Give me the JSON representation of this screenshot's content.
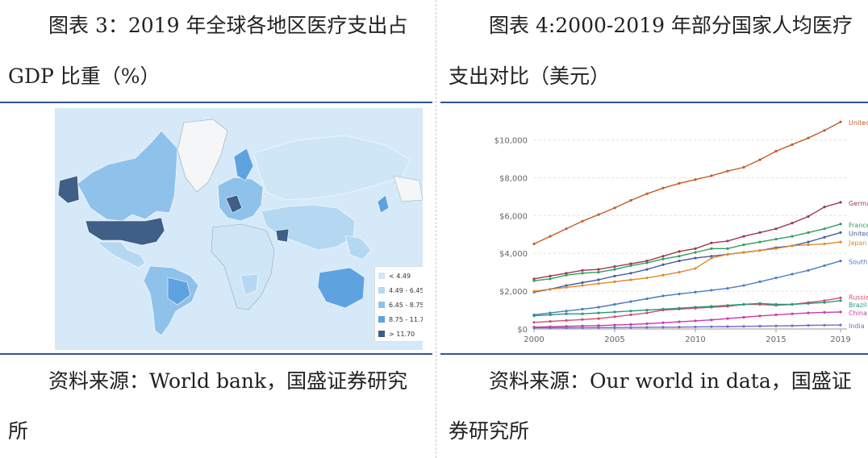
{
  "left": {
    "caption": "图表 3：2019 年全球各地区医疗支出占 GDP 比重（%）",
    "legend": [
      {
        "label": "< 4.49",
        "color": "#cfe6f7"
      },
      {
        "label": "4.49 - 6.45",
        "color": "#b4d8f2"
      },
      {
        "label": "6.45 - 8.75",
        "color": "#8fc2ea"
      },
      {
        "label": "8.75 - 11.70",
        "color": "#5ea3e0"
      },
      {
        "label": "> 11.70",
        "color": "#3f5f86"
      }
    ],
    "source": "资料来源：World bank，国盛证券研究所"
  },
  "right": {
    "caption": "图表 4:2000-2019 年部分国家人均医疗支出对比（美元）",
    "source": "资料来源：Our world in data，国盛证券研究所"
  },
  "chart_data": {
    "type": "line",
    "x": [
      2000,
      2001,
      2002,
      2003,
      2004,
      2005,
      2006,
      2007,
      2008,
      2009,
      2010,
      2011,
      2012,
      2013,
      2014,
      2015,
      2016,
      2017,
      2018,
      2019
    ],
    "xticks": [
      "2000",
      "2005",
      "2010",
      "2015",
      "2019"
    ],
    "yticks": [
      "$0",
      "$2,000",
      "$4,000",
      "$6,000",
      "$8,000",
      "$10,000"
    ],
    "ylim": [
      0,
      11000
    ],
    "xlim": [
      2000,
      2019
    ],
    "series": [
      {
        "name": "United",
        "color": "#c65a28",
        "values": [
          4500,
          4900,
          5300,
          5700,
          6050,
          6400,
          6800,
          7150,
          7450,
          7700,
          7900,
          8100,
          8350,
          8550,
          8950,
          9400,
          9750,
          10100,
          10500,
          10950
        ]
      },
      {
        "name": "Germa",
        "color": "#9b3a4f",
        "values": [
          2650,
          2800,
          2950,
          3100,
          3150,
          3300,
          3450,
          3600,
          3850,
          4100,
          4250,
          4550,
          4650,
          4900,
          5100,
          5300,
          5600,
          5950,
          6450,
          6700
        ]
      },
      {
        "name": "France",
        "color": "#2e9e5c",
        "values": [
          2550,
          2650,
          2850,
          2950,
          3000,
          3150,
          3350,
          3500,
          3700,
          3850,
          4050,
          4250,
          4250,
          4450,
          4600,
          4750,
          4900,
          5100,
          5300,
          5550
        ]
      },
      {
        "name": "United",
        "color": "#4a5aa8",
        "values": [
          1950,
          2100,
          2300,
          2450,
          2600,
          2800,
          2950,
          3150,
          3400,
          3600,
          3750,
          3850,
          3950,
          4050,
          4150,
          4300,
          4400,
          4600,
          4850,
          5100
        ]
      },
      {
        "name": "Japan",
        "color": "#e08a2a",
        "values": [
          2000,
          2100,
          2200,
          2300,
          2400,
          2500,
          2600,
          2700,
          2850,
          3000,
          3200,
          3750,
          3950,
          4050,
          4150,
          4250,
          4400,
          4450,
          4500,
          4600
        ]
      },
      {
        "name": "South",
        "color": "#4a7cc2",
        "values": [
          750,
          850,
          950,
          1050,
          1150,
          1300,
          1450,
          1600,
          1750,
          1850,
          1950,
          2050,
          2150,
          2300,
          2500,
          2700,
          2900,
          3100,
          3350,
          3600
        ]
      },
      {
        "name": "Russia",
        "color": "#d94a6a",
        "values": [
          350,
          400,
          450,
          500,
          550,
          650,
          750,
          850,
          1000,
          1050,
          1100,
          1150,
          1200,
          1300,
          1300,
          1250,
          1300,
          1400,
          1500,
          1650
        ]
      },
      {
        "name": "Brazil",
        "color": "#259a7a",
        "values": [
          700,
          750,
          800,
          800,
          850,
          900,
          950,
          1000,
          1050,
          1100,
          1150,
          1200,
          1250,
          1300,
          1350,
          1300,
          1300,
          1350,
          1400,
          1500
        ]
      },
      {
        "name": "China",
        "color": "#c83aa8",
        "values": [
          100,
          120,
          140,
          160,
          180,
          210,
          240,
          280,
          330,
          380,
          430,
          480,
          550,
          620,
          690,
          750,
          800,
          850,
          880,
          900
        ]
      },
      {
        "name": "India",
        "color": "#7a6ac8",
        "values": [
          60,
          62,
          65,
          68,
          72,
          76,
          82,
          88,
          95,
          100,
          110,
          120,
          130,
          140,
          150,
          160,
          170,
          190,
          200,
          210
        ]
      }
    ]
  }
}
